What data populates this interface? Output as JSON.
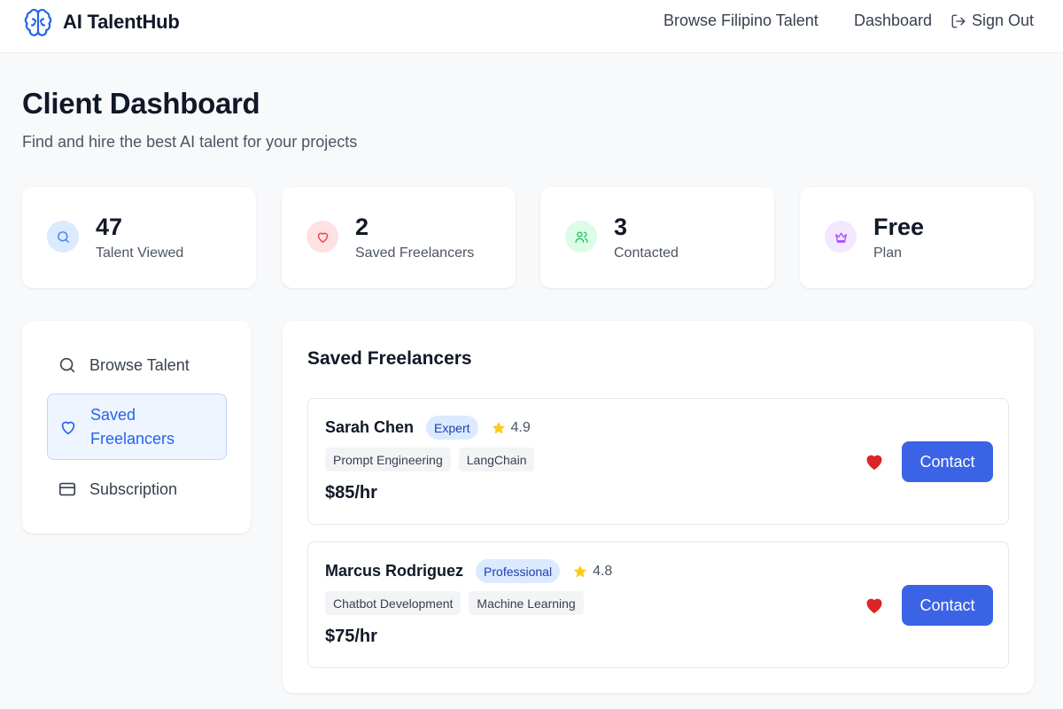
{
  "header": {
    "brand": "AI TalentHub",
    "nav": {
      "browse": "Browse Filipino Talent",
      "dashboard": "Dashboard",
      "signout": "Sign Out"
    },
    "logo_icon": "brain-icon"
  },
  "page": {
    "title": "Client Dashboard",
    "subtitle": "Find and hire the best AI talent for your projects"
  },
  "stats": [
    {
      "value": "47",
      "label": "Talent Viewed",
      "icon": "search-icon",
      "icon_color": "#3b82f6",
      "icon_bg": "#dbeafe"
    },
    {
      "value": "2",
      "label": "Saved Freelancers",
      "icon": "heart-icon",
      "icon_color": "#ef4444",
      "icon_bg": "#fee2e2"
    },
    {
      "value": "3",
      "label": "Contacted",
      "icon": "users-icon",
      "icon_color": "#22c55e",
      "icon_bg": "#dcfce7"
    },
    {
      "value": "Free",
      "label": "Plan",
      "icon": "crown-icon",
      "icon_color": "#a855f7",
      "icon_bg": "#f3e8ff"
    }
  ],
  "sidebar": {
    "items": [
      {
        "label": "Browse Talent",
        "icon": "search-icon",
        "active": false
      },
      {
        "label": "Saved Freelancers",
        "icon": "heart-icon",
        "active": true
      },
      {
        "label": "Subscription",
        "icon": "credit-card-icon",
        "active": false
      }
    ]
  },
  "saved": {
    "title": "Saved Freelancers",
    "freelancers": [
      {
        "name": "Sarah Chen",
        "level": "Expert",
        "rating": "4.9",
        "skills": [
          "Prompt Engineering",
          "LangChain"
        ],
        "rate": "$85/hr",
        "saved": true,
        "contact_label": "Contact"
      },
      {
        "name": "Marcus Rodriguez",
        "level": "Professional",
        "rating": "4.8",
        "skills": [
          "Chatbot Development",
          "Machine Learning"
        ],
        "rate": "$75/hr",
        "saved": true,
        "contact_label": "Contact"
      }
    ]
  },
  "colors": {
    "accent": "#3b63e6",
    "active_bg": "#eef5ff",
    "heart": "#dc2626",
    "star": "#facc15"
  }
}
